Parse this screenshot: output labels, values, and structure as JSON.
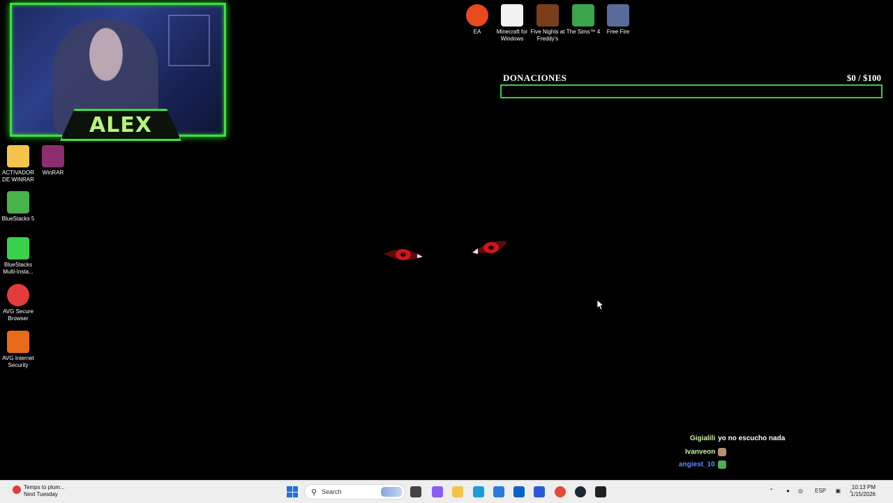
{
  "webcam": {
    "streamer_name": "ALEX"
  },
  "desktop_icons_top": [
    {
      "label": "EA",
      "icon": "ea-app-icon",
      "color": "#e8491e"
    },
    {
      "label": "Minecraft for Windows",
      "icon": "file-icon",
      "color": "#f2f2f2"
    },
    {
      "label": "Five Nights at Freddy's",
      "icon": "fnaf-icon",
      "color": "#7a3e1c"
    },
    {
      "label": "The Sims™ 4",
      "icon": "sims-icon",
      "color": "#3aa54b"
    },
    {
      "label": "Free Fire",
      "icon": "free-fire-icon",
      "color": "#5a6b9a"
    }
  ],
  "desktop_icons_left": [
    {
      "label": "ACTIVADOR DE WINRAR",
      "icon": "folder-icon",
      "color": "#f2c44b"
    },
    {
      "label": "WinRAR",
      "icon": "winrar-icon",
      "color": "#8b2d6f"
    },
    {
      "label": "BlueStacks 5",
      "icon": "bluestacks-icon",
      "color": "#47b34a"
    },
    {
      "label": "BlueStacks Multi-Insta...",
      "icon": "bluestacks-multi-icon",
      "color": "#3ad14a"
    },
    {
      "label": "AVG Secure Browser",
      "icon": "avg-browser-icon",
      "color": "#e43c3c"
    },
    {
      "label": "AVG Internet Security",
      "icon": "avg-security-icon",
      "color": "#e86a1b"
    }
  ],
  "donations": {
    "label": "DONACIONES",
    "amount_text": "$0  / $100",
    "current": 0,
    "goal": 100,
    "accent": "#37d137"
  },
  "chat": [
    {
      "user": "Gigialili",
      "message": "yo no escucho nada",
      "user_color": "#c9f2b0",
      "emote": ""
    },
    {
      "user": "Ivanveon",
      "message": "",
      "user_color": "#c9f2b0",
      "emote": "cat-emote-icon"
    },
    {
      "user": "angiest_10",
      "message": "",
      "user_color": "#5b8cff",
      "emote": "smile-emote-icon"
    }
  ],
  "taskbar": {
    "weather_line1": "Temps to plum...",
    "weather_line2": "Next Tuesday",
    "weather_badge": "5",
    "search_placeholder": "Search",
    "apps": [
      {
        "name": "task-view-icon",
        "color": "#444444"
      },
      {
        "name": "copilot-icon",
        "color": "#8a5cf6"
      },
      {
        "name": "file-explorer-icon",
        "color": "#f2c44b"
      },
      {
        "name": "edge-icon",
        "color": "#1f9bd8"
      },
      {
        "name": "store-icon",
        "color": "#2a7ae2"
      },
      {
        "name": "outlook-icon",
        "color": "#0a64c8"
      },
      {
        "name": "app-icon",
        "color": "#2a5bd7"
      },
      {
        "name": "chrome-icon",
        "color": "#e44a3a"
      },
      {
        "name": "steam-icon",
        "color": "#1b2838"
      },
      {
        "name": "obs-icon",
        "color": "#222222"
      }
    ],
    "tray_language": "ESP",
    "time": "10:13 PM",
    "date": "1/15/2026"
  }
}
